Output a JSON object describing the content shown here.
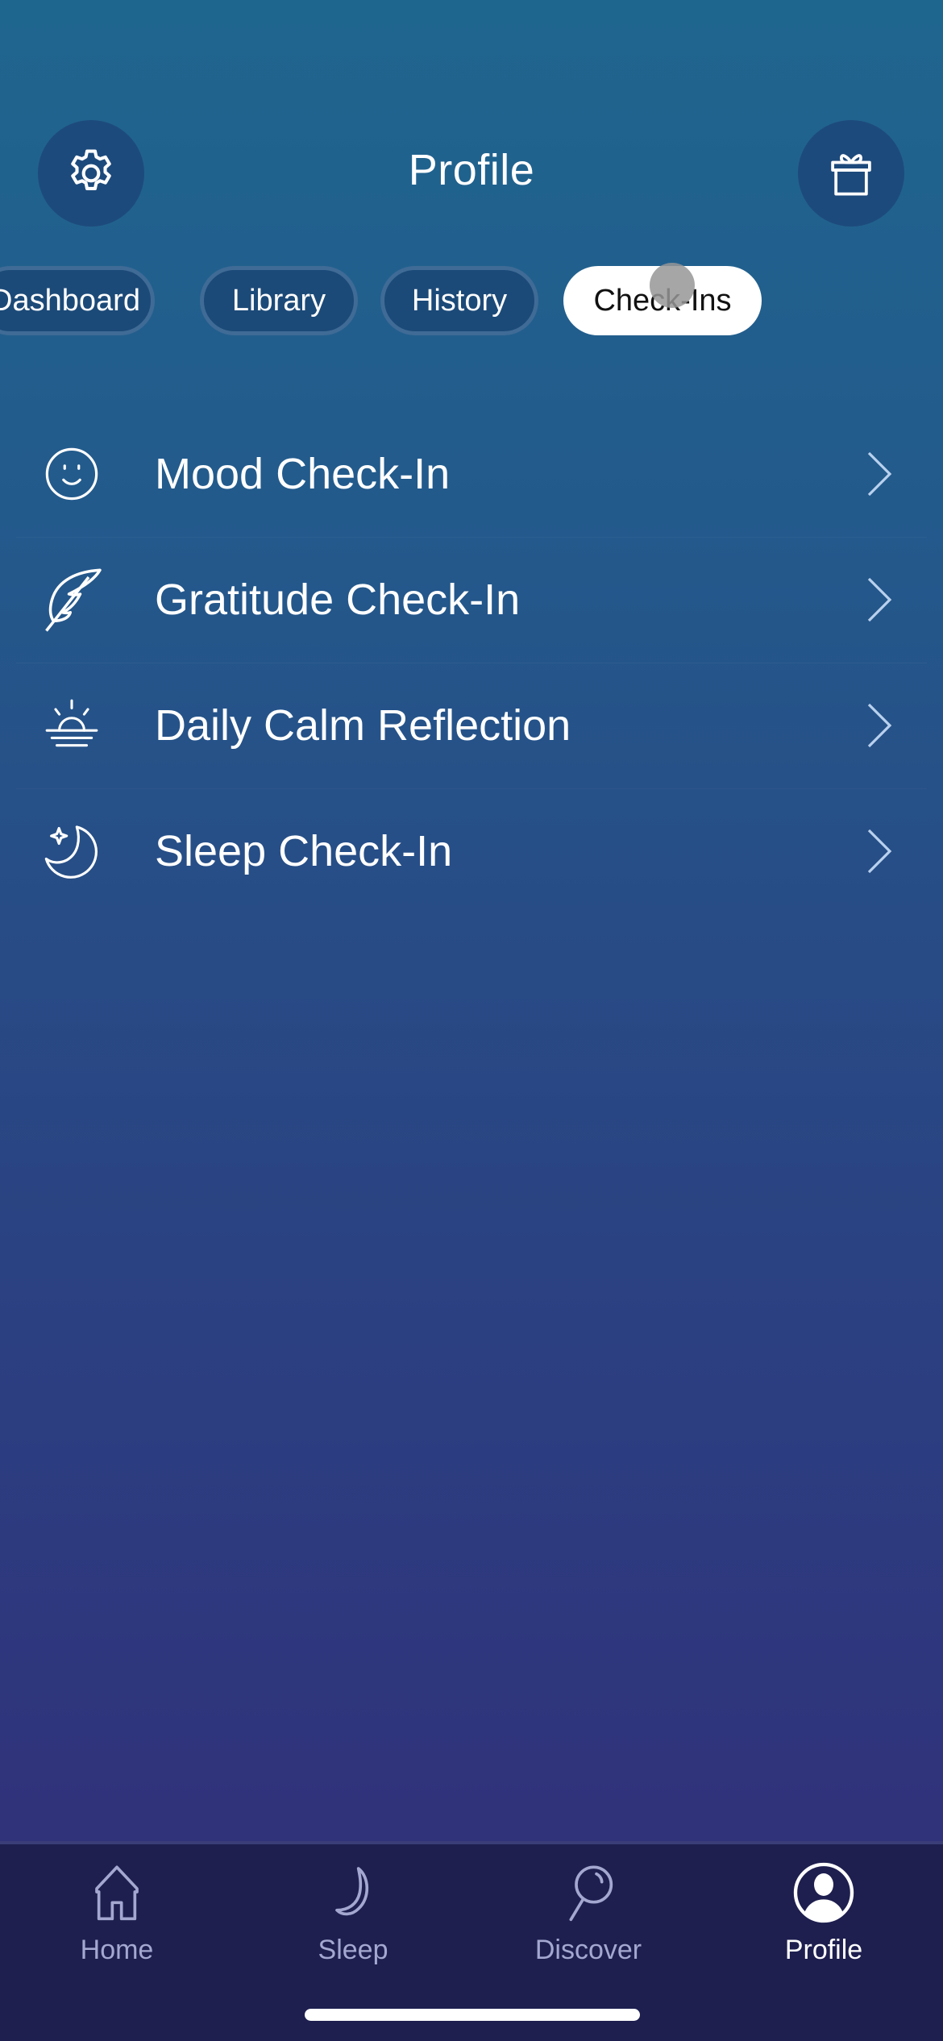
{
  "header": {
    "title": "Profile",
    "settings_icon": "gear-icon",
    "gift_icon": "gift-icon"
  },
  "tabs": [
    {
      "label": "Dashboard",
      "active": false
    },
    {
      "label": "Library",
      "active": false
    },
    {
      "label": "History",
      "active": false
    },
    {
      "label": "Check-Ins",
      "active": true
    }
  ],
  "checkins": [
    {
      "label": "Mood Check-In",
      "icon": "smiley-icon"
    },
    {
      "label": "Gratitude Check-In",
      "icon": "feather-icon"
    },
    {
      "label": "Daily Calm Reflection",
      "icon": "sunrise-icon"
    },
    {
      "label": "Sleep Check-In",
      "icon": "moon-star-icon"
    }
  ],
  "tabbar": [
    {
      "label": "Home",
      "icon": "home-icon",
      "active": false
    },
    {
      "label": "Sleep",
      "icon": "moon-icon",
      "active": false
    },
    {
      "label": "Discover",
      "icon": "search-icon",
      "active": false
    },
    {
      "label": "Profile",
      "icon": "profile-icon",
      "active": true
    }
  ],
  "colors": {
    "gradient_top": "#1f668f",
    "gradient_bottom": "#30317a",
    "tabbar_bg": "#1e1f4f",
    "inactive_tab": "#a4a8d0",
    "active_pill": "#ffffff"
  }
}
